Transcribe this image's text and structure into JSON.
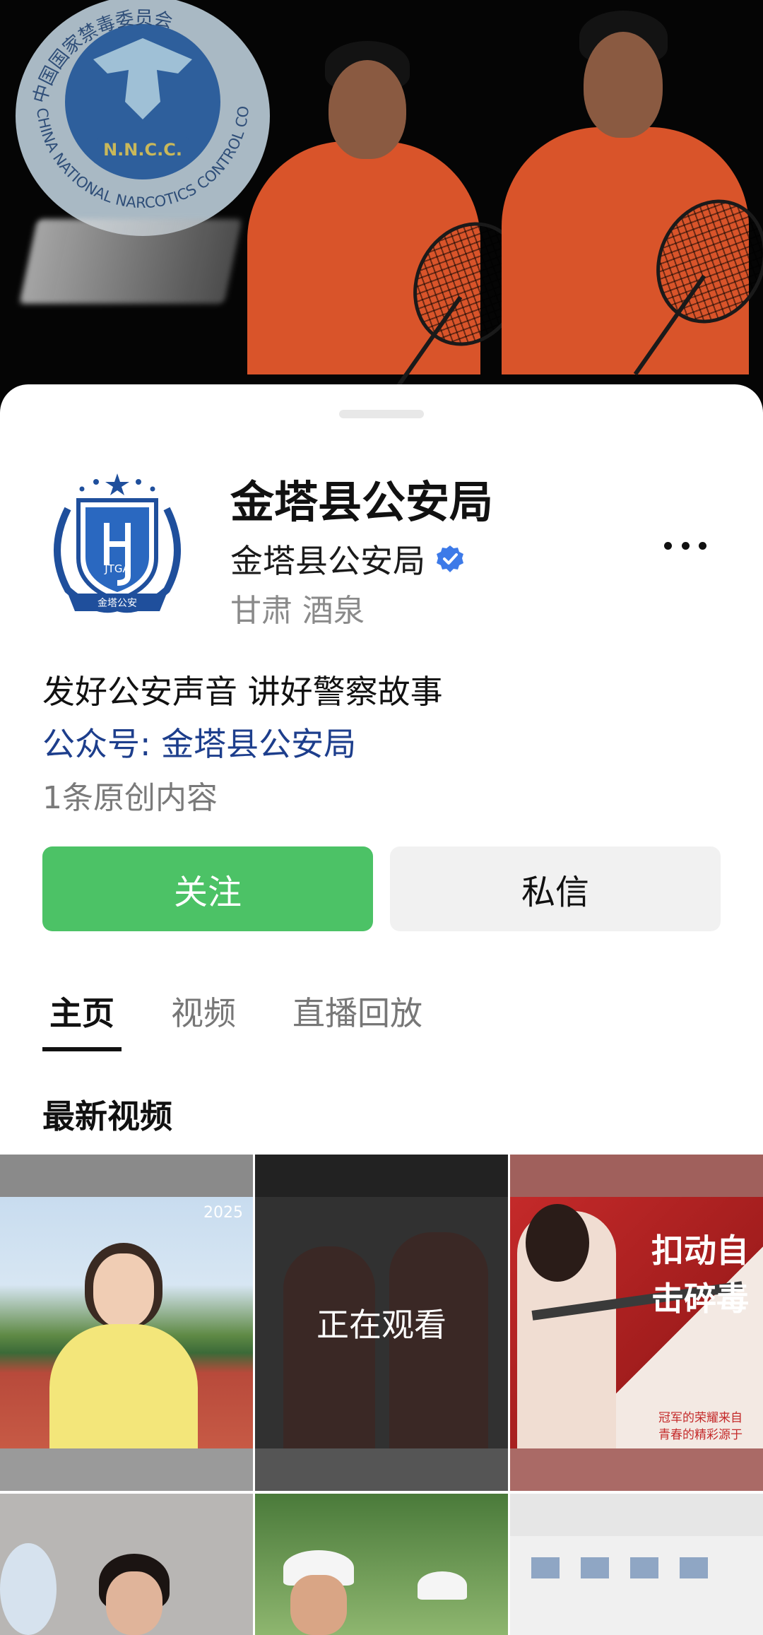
{
  "banner": {
    "emblem_text": "CHINA NATIONAL NARCOTICS CONTROL COMMISSION",
    "emblem_top_text": "中国国家禁毒委员会",
    "emblem_initials": "N.N.C.C."
  },
  "profile": {
    "title": "金塔县公安局",
    "account_name": "金塔县公安局",
    "location": "甘肃 酒泉",
    "avatar_label": "JTGA",
    "avatar_motto": "金塔公安"
  },
  "bio": {
    "slogan": "发好公安声音 讲好警察故事",
    "gzh_label": "公众号: ",
    "gzh_name": "金塔县公安局",
    "original_count": "1条原创内容"
  },
  "actions": {
    "follow": "关注",
    "message": "私信"
  },
  "tabs": [
    {
      "label": "主页",
      "active": true
    },
    {
      "label": "视频",
      "active": false
    },
    {
      "label": "直播回放",
      "active": false
    }
  ],
  "section": {
    "latest_videos": "最新视频"
  },
  "videos": {
    "watching_label": "正在观看",
    "tile3_headline_1": "扣动自",
    "tile3_headline_2": "击碎毒",
    "tile3_caption_1": "冠军的荣耀来自",
    "tile3_caption_2": "青春的精彩源于",
    "tile1_year": "2025"
  },
  "colors": {
    "follow_green": "#4cc266",
    "link_blue": "#1d3e8c",
    "verified_blue": "#3d7ae8"
  }
}
